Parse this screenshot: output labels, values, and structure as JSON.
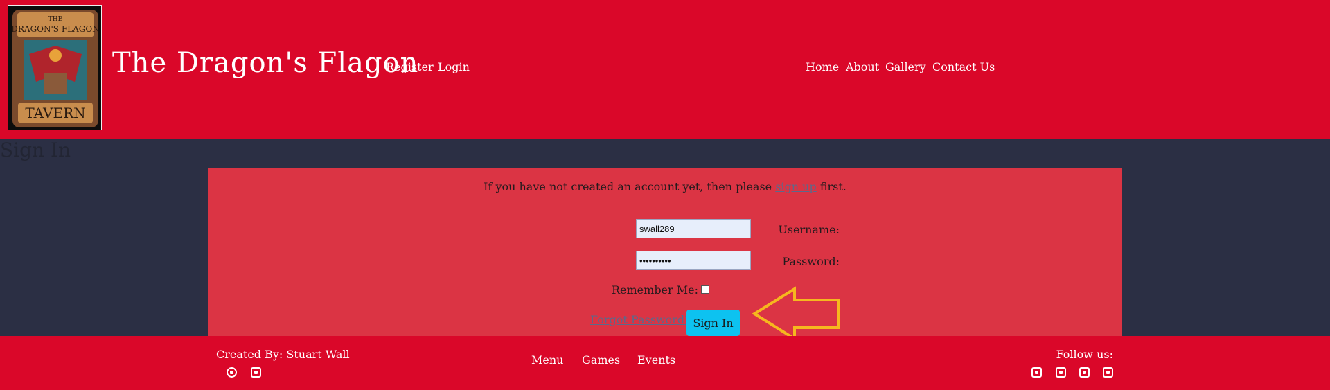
{
  "header": {
    "logo": {
      "top_text": "THE",
      "main_text": "DRAGON'S FLAGON",
      "bottom_text": "TAVERN"
    },
    "site_title": "The Dragon's Flagon",
    "auth_links": [
      {
        "label": "Register"
      },
      {
        "label": "Login"
      }
    ],
    "main_nav": [
      {
        "label": "Home"
      },
      {
        "label": "About"
      },
      {
        "label": "Gallery"
      },
      {
        "label": "Contact Us"
      }
    ]
  },
  "page": {
    "heading": "Sign In",
    "intro_before": "If you have not created an account yet, then please ",
    "intro_link": "sign up",
    "intro_after": " first."
  },
  "form": {
    "username_label": "Username:",
    "username_value": "swall289",
    "password_label": "Password:",
    "password_value": "••••••••••",
    "remember_label": "Remember Me:",
    "forgot_label": "Forgot Password?",
    "submit_label": "Sign In",
    "annotation_color": "#f6b71e"
  },
  "footer": {
    "credit": "Created By: Stuart Wall",
    "credit_icons": [
      "github-icon",
      "linkedin-icon"
    ],
    "links": [
      {
        "label": "Menu"
      },
      {
        "label": "Games"
      },
      {
        "label": "Events"
      }
    ],
    "follow_label": "Follow us:",
    "social_icons": [
      "facebook-icon",
      "twitter-icon",
      "instagram-icon",
      "youtube-icon"
    ]
  },
  "colors": {
    "brand_red": "#da0729",
    "panel_red": "#db3444",
    "page_bg": "#2b2f44",
    "button_blue": "#0dc2f0"
  }
}
